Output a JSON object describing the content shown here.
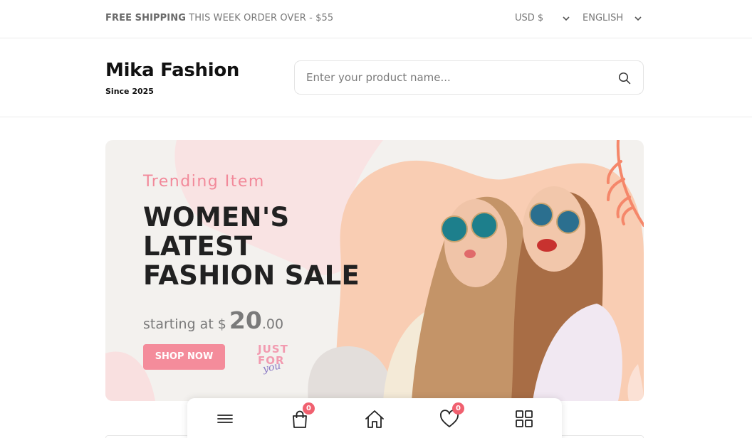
{
  "topbar": {
    "shipping_bold": "FREE SHIPPING",
    "shipping_rest": " THIS WEEK ORDER OVER - $55",
    "currency": "USD $",
    "language": "ENGLISH"
  },
  "header": {
    "brand": "Mika Fashion",
    "tagline": "Since 2025",
    "search_placeholder": "Enter your product name..."
  },
  "banner": {
    "subtitle": "Trending Item",
    "title_line1": "WOMEN'S",
    "title_line2": "LATEST",
    "title_line3": "FASHION SALE",
    "price_prefix": "starting at $",
    "price_whole": "20",
    "price_cents": ".00",
    "cta": "SHOP NOW",
    "stamp_line1": "JUST",
    "stamp_line2": "FOR",
    "stamp_line3": "you"
  },
  "bottom_nav": {
    "cart_count": "0",
    "wishlist_count": "0",
    "icons": [
      "menu-icon",
      "bag-icon",
      "home-icon",
      "heart-icon",
      "grid-icon"
    ]
  },
  "colors": {
    "accent_pink": "#f48c9b",
    "subtitle_pink": "#f2899a",
    "badge_red": "#f0606f",
    "banner_bg": "#f3f1ee",
    "peach": "#f9cdb3",
    "coral": "#f5876a"
  }
}
